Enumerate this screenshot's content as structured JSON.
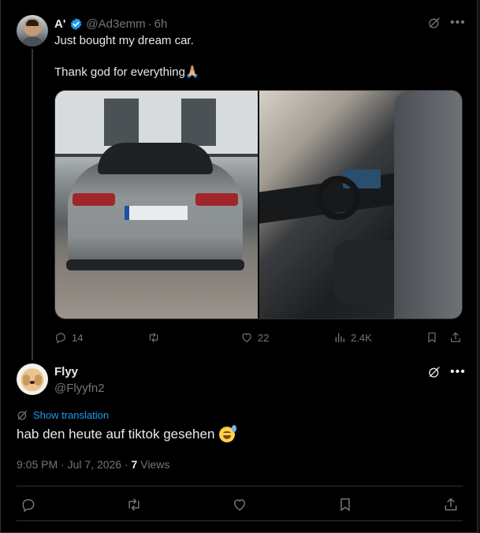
{
  "parent_tweet": {
    "author_name": "A'",
    "handle": "@Ad3emm",
    "separator": "·",
    "time": "6h",
    "lines": [
      "Just bought my dream car.",
      "Thank god for everything🙏🏼"
    ],
    "actions": {
      "replies": "14",
      "reposts": "",
      "likes": "22",
      "views": "2.4K"
    }
  },
  "reply_tweet": {
    "author_name": "Flyy",
    "handle": "@Flyyfn2",
    "show_translation": "Show translation",
    "text": "hab den heute auf tiktok gesehen",
    "time": "9:05 PM",
    "separator": "·",
    "date": "Jul 7, 2026",
    "separator2": "·",
    "views_count": "7",
    "views_label": "Views"
  },
  "icons": {
    "verified": "verified-badge-icon",
    "grok": "grok-icon",
    "more": "more-icon",
    "reply": "reply-icon",
    "repost": "repost-icon",
    "like": "like-icon",
    "views": "views-icon",
    "bookmark": "bookmark-icon",
    "share": "share-icon"
  },
  "colors": {
    "background": "#000000",
    "primary_text": "#e7e9ea",
    "secondary_text": "#71767b",
    "link": "#1d9bf0",
    "divider": "#2f3336",
    "verified": "#1d9bf0"
  }
}
